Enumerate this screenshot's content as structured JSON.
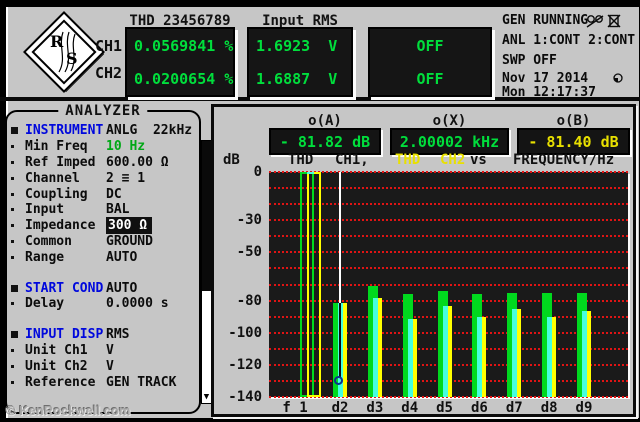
{
  "colors": {
    "bg": "#c6c6c6",
    "panel_black": "#151515",
    "green": "#00de3c",
    "bar_green": "#00d91e",
    "bar_cyan": "#46ffe0",
    "bar_yellow": "#ffff00",
    "grid_red": "#e01414",
    "menu_blue": "#0008dd"
  },
  "logo": {
    "letter_top": "R",
    "letter_bottom": "S"
  },
  "top": {
    "ch_labels": [
      "CH1",
      "CH2"
    ],
    "thd": {
      "title": "THD 23456789",
      "rows": [
        "0.0569841 %",
        "0.0200654 %"
      ]
    },
    "input_rms": {
      "title": "Input RMS",
      "rows": [
        "1.6923  V",
        "1.6887  V"
      ]
    },
    "aux": {
      "rows": [
        "OFF",
        "OFF"
      ]
    },
    "status": {
      "gen": "GEN RUNNING",
      "anl": "ANL 1:CONT 2:CONT",
      "swp": "SWP OFF",
      "date": "Nov 17 2014",
      "time": "Mon 12:17:37",
      "icons": [
        "crossed-dial-icon",
        "crossed-frame-icon",
        "quarter-disc-icon"
      ]
    }
  },
  "menu": {
    "title": "ANALYZER",
    "items": [
      {
        "label": "INSTRUMENT",
        "value": "ANLG  22kHz",
        "type": "header"
      },
      {
        "label": "Min Freq",
        "value": "10 Hz",
        "value_color": "green"
      },
      {
        "label": "Ref Imped",
        "value": "600.00 Ω"
      },
      {
        "label": "Channel",
        "value": "2 ≡ 1"
      },
      {
        "label": "Coupling",
        "value": "DC"
      },
      {
        "label": "Input",
        "value": "BAL"
      },
      {
        "label": "Impedance",
        "value": "300 Ω",
        "highlight": true
      },
      {
        "label": "Common",
        "value": "GROUND"
      },
      {
        "label": "Range",
        "value": "AUTO"
      },
      {
        "label": "START COND",
        "value": "AUTO",
        "type": "header",
        "gap": true
      },
      {
        "label": "Delay",
        "value": "0.0000 s"
      },
      {
        "label": "INPUT DISP",
        "value": "RMS",
        "type": "header",
        "gap": true
      },
      {
        "label": "Unit Ch1",
        "value": "V"
      },
      {
        "label": "Unit Ch2",
        "value": "V"
      },
      {
        "label": "Reference",
        "value": "GEN TRACK"
      }
    ]
  },
  "chart": {
    "readouts": [
      {
        "label": "o(A)",
        "value": "- 81.82 dB",
        "color": "#00de3c"
      },
      {
        "label": "o(X)",
        "value": "2.00002 kHz",
        "color": "#00de3c"
      },
      {
        "label": "o(B)",
        "value": "- 81.40 dB",
        "color": "#e8e000"
      }
    ],
    "legend": {
      "unit": "dB",
      "thd1": "THD",
      "ch1": "CH1,",
      "thd2": "THD",
      "ch2": "CH2",
      "vs": "vs",
      "xlabel": "FREQUENCY/Hz"
    }
  },
  "chart_data": {
    "type": "bar",
    "title": "THD CH1, THD CH2 vs FREQUENCY/Hz",
    "ylabel": "dB",
    "xlabel": "FREQUENCY/Hz",
    "ylim": [
      -140,
      0
    ],
    "grid_step_db": 10,
    "ytick_labels": [
      0,
      -30,
      -50,
      -80,
      -100,
      -120,
      -140
    ],
    "categories": [
      "f 1",
      "d2",
      "d3",
      "d4",
      "d5",
      "d6",
      "d7",
      "d8",
      "d9"
    ],
    "series": [
      {
        "name": "THD CH1",
        "color": "#00d91e",
        "values": [
          0,
          -81.82,
          -71,
          -76,
          -74,
          -76,
          -75,
          -75,
          -75
        ]
      },
      {
        "name": "THD CH2",
        "color": "#ffff00",
        "values": [
          0,
          -81.4,
          -78.5,
          -91.5,
          -83.5,
          -90,
          -85,
          -90,
          -86.5
        ]
      }
    ],
    "fundamental_style": "outline",
    "cursor": {
      "category_index": 1,
      "a_db": "- 81.82 dB",
      "x_value": "2.00002 kHz",
      "b_db": "- 81.40 dB"
    }
  },
  "watermark": "© KenRockwell.com"
}
